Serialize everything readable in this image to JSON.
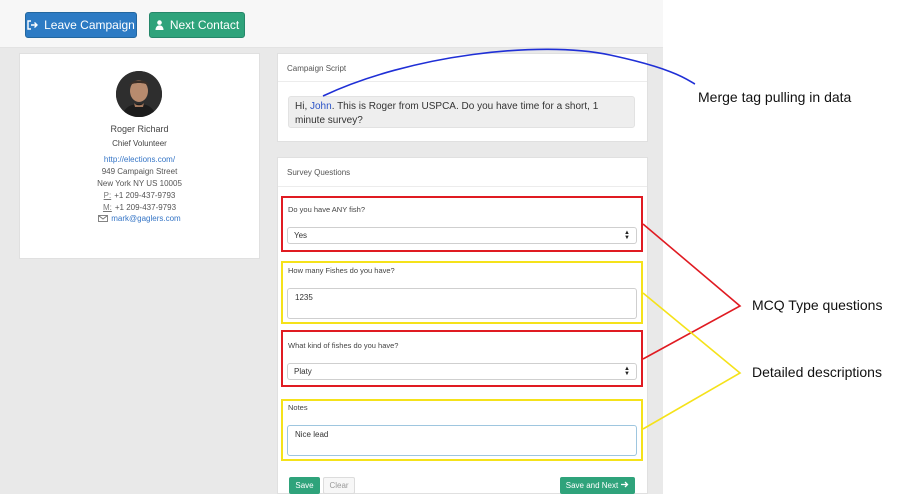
{
  "toolbar": {
    "leave_label": "Leave Campaign",
    "next_contact_label": "Next Contact"
  },
  "contact": {
    "name": "Roger Richard",
    "role": "Chief Volunteer",
    "website": "http://elections.com/",
    "address_line1": "949 Campaign Street",
    "address_line2": "New York NY US 10005",
    "phone_p_prefix": "P:",
    "phone_p": "+1 209-437-9793",
    "phone_m_prefix": "M:",
    "phone_m": "+1 209-437-9793",
    "email": "mark@gaglers.com"
  },
  "script_panel": {
    "title": "Campaign Script",
    "text_before": "Hi, ",
    "merge_value": "John",
    "text_after": ". This is Roger from USPCA. Do you have time for a short, 1 minute survey?"
  },
  "survey": {
    "title": "Survey Questions",
    "questions": [
      {
        "label": "Do you have ANY fish?",
        "value": "Yes"
      },
      {
        "label": "How many Fishes do you have?",
        "value": "1235"
      },
      {
        "label": "What kind of fishes do you have?",
        "value": "Platy"
      },
      {
        "label": "Notes",
        "value": "Nice lead"
      }
    ],
    "save_label": "Save",
    "clear_label": "Clear",
    "save_next_label": "Save and Next"
  },
  "annotations": {
    "merge_tag": "Merge tag pulling in data",
    "mcq": "MCQ Type questions",
    "detailed": "Detailed descriptions"
  },
  "colors": {
    "primary_blue": "#2d7bc4",
    "primary_green": "#2fa37b",
    "merge_tag_blue": "#2a53c7",
    "mcq_outline_red": "#e01b22",
    "detail_outline_yellow": "#f5e21a",
    "annotation_line_blue": "#1f2fd6"
  }
}
